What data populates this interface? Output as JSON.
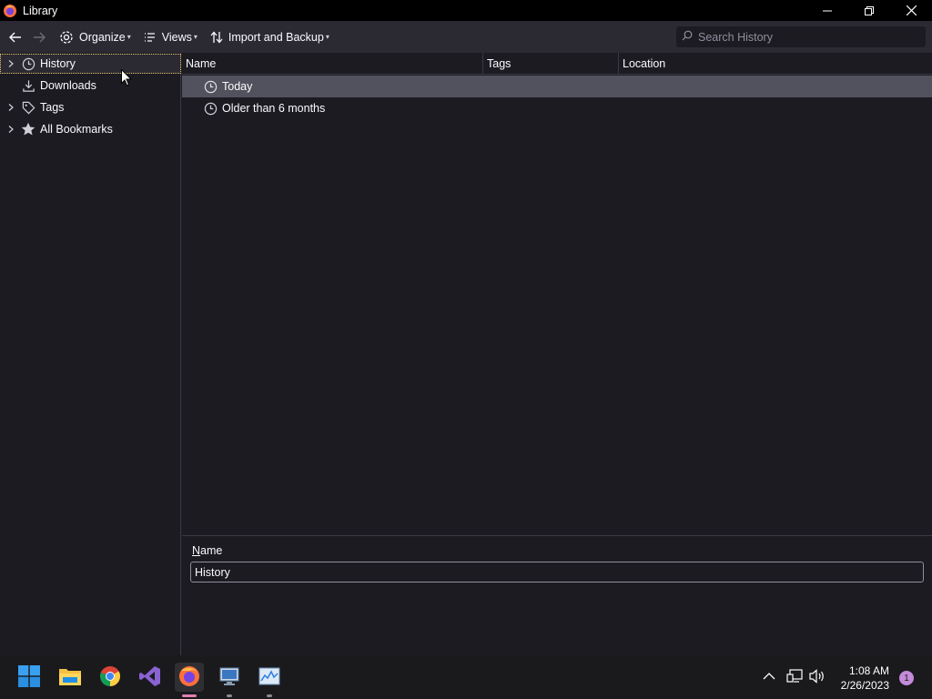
{
  "window": {
    "title": "Library"
  },
  "toolbar": {
    "organize_label": "Organize",
    "views_label": "Views",
    "import_label": "Import and Backup",
    "search_placeholder": "Search History"
  },
  "sidebar": {
    "items": [
      {
        "label": "History",
        "icon": "clock-icon",
        "expandable": true,
        "selected": true
      },
      {
        "label": "Downloads",
        "icon": "download-icon",
        "expandable": false
      },
      {
        "label": "Tags",
        "icon": "tag-icon",
        "expandable": true
      },
      {
        "label": "All Bookmarks",
        "icon": "star-icon",
        "expandable": true
      }
    ]
  },
  "table": {
    "columns": [
      "Name",
      "Tags",
      "Location"
    ],
    "rows": [
      {
        "name": "Today",
        "selected": true
      },
      {
        "name": "Older than 6 months"
      }
    ]
  },
  "details": {
    "name_label_accesskey": "N",
    "name_label_rest": "ame",
    "name_value": "History"
  },
  "taskbar": {
    "time": "1:08 AM",
    "date": "2/26/2023",
    "notification_count": "1"
  },
  "colors": {
    "background": "#1c1b22",
    "toolbar": "#2b2a33",
    "selection": "#52525e",
    "focus_outline": "#e8c96a"
  }
}
